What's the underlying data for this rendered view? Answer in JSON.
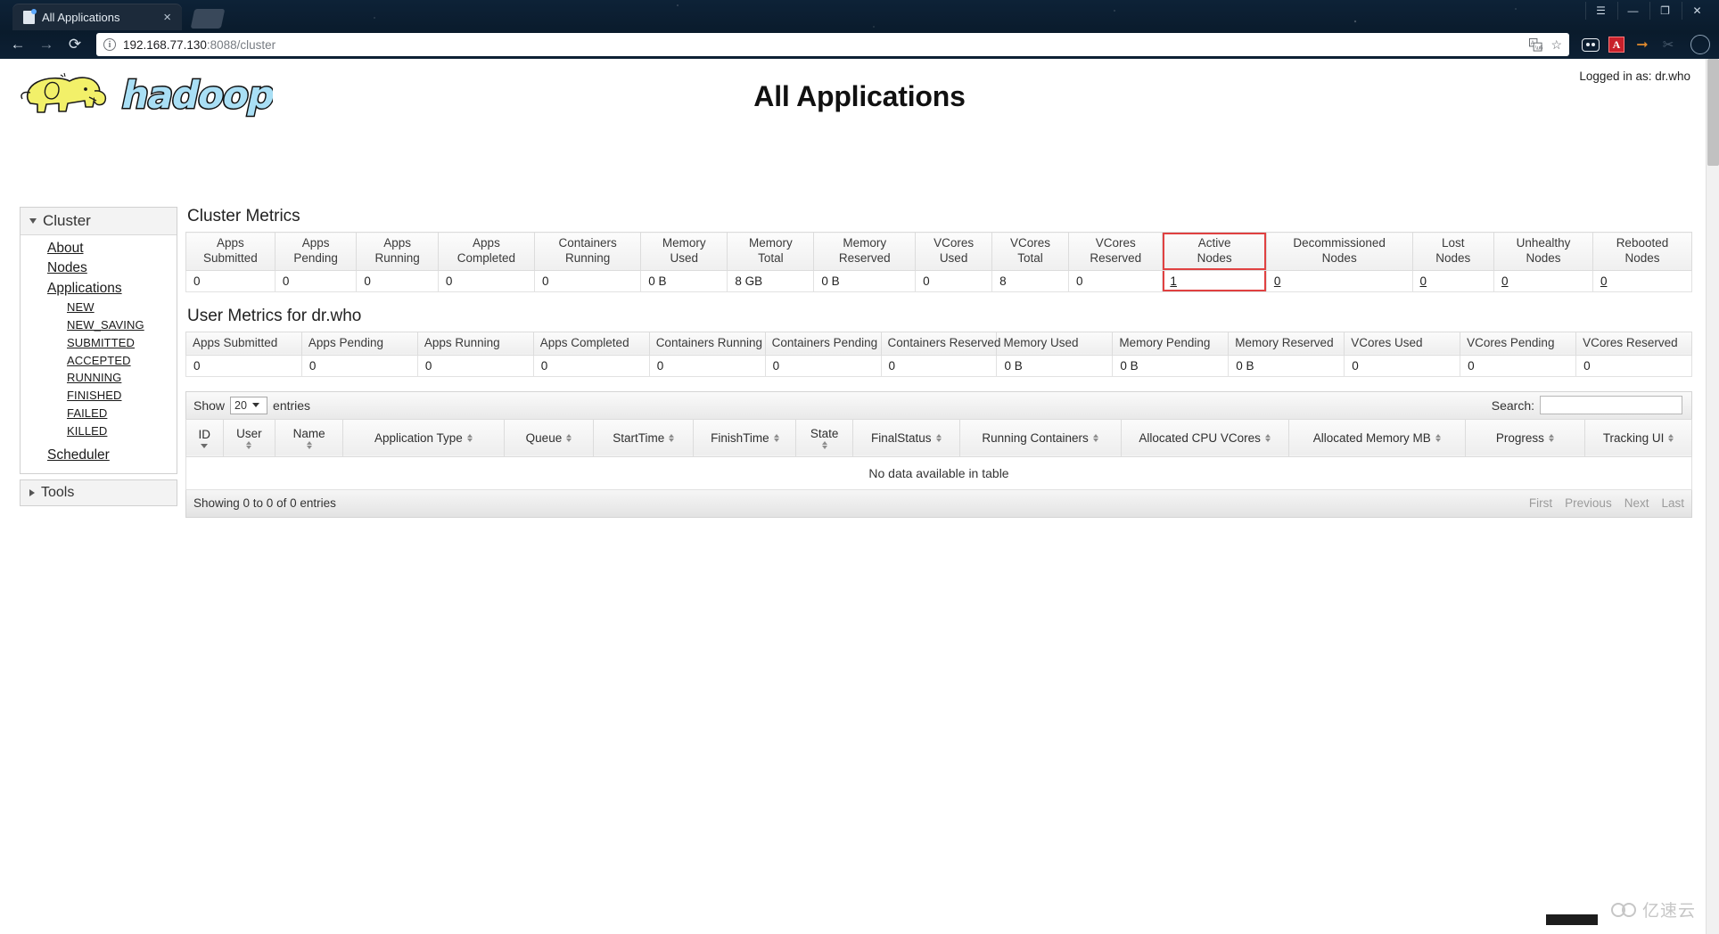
{
  "browser": {
    "tab": {
      "title": "All Applications",
      "close_label": "×",
      "favicon": "page-icon"
    },
    "window_controls": {
      "profile": "☰",
      "minimize": "—",
      "maximize": "❐",
      "close": "✕"
    },
    "nav": {
      "back": "←",
      "forward": "→",
      "reload": "⟳"
    },
    "url": {
      "host": "192.168.77.130",
      "port_path": ":8088/cluster",
      "info_icon": "ⓘ"
    },
    "omni_actions": {
      "translate": "translate-icon",
      "bookmark": "☆"
    },
    "extensions": [
      "oval-icon",
      "pdf-icon",
      "download-arrow-icon",
      "scissors-icon"
    ]
  },
  "header": {
    "logo_text": "hadoop",
    "logged_in": "Logged in as: dr.who",
    "title": "All Applications"
  },
  "sidebar": {
    "cluster": {
      "label": "Cluster",
      "links": [
        "About",
        "Nodes",
        "Applications"
      ],
      "app_states": [
        "NEW",
        "NEW_SAVING",
        "SUBMITTED",
        "ACCEPTED",
        "RUNNING",
        "FINISHED",
        "FAILED",
        "KILLED"
      ],
      "scheduler": "Scheduler"
    },
    "tools": {
      "label": "Tools"
    }
  },
  "cluster_metrics": {
    "title": "Cluster Metrics",
    "columns": [
      {
        "line1": "Apps",
        "line2": "Submitted"
      },
      {
        "line1": "Apps",
        "line2": "Pending"
      },
      {
        "line1": "Apps",
        "line2": "Running"
      },
      {
        "line1": "Apps",
        "line2": "Completed"
      },
      {
        "line1": "Containers",
        "line2": "Running"
      },
      {
        "line1": "Memory",
        "line2": "Used"
      },
      {
        "line1": "Memory",
        "line2": "Total"
      },
      {
        "line1": "Memory",
        "line2": "Reserved"
      },
      {
        "line1": "VCores",
        "line2": "Used"
      },
      {
        "line1": "VCores",
        "line2": "Total"
      },
      {
        "line1": "VCores",
        "line2": "Reserved"
      },
      {
        "line1": "Active",
        "line2": "Nodes"
      },
      {
        "line1": "Decommissioned",
        "line2": "Nodes"
      },
      {
        "line1": "Lost",
        "line2": "Nodes"
      },
      {
        "line1": "Unhealthy",
        "line2": "Nodes"
      },
      {
        "line1": "Rebooted",
        "line2": "Nodes"
      }
    ],
    "values": [
      "0",
      "0",
      "0",
      "0",
      "0",
      "0 B",
      "8 GB",
      "0 B",
      "0",
      "8",
      "0",
      "1",
      "0",
      "0",
      "0",
      "0"
    ],
    "highlight_column": "Active Nodes",
    "highlight_color": "#e04141"
  },
  "user_metrics": {
    "title": "User Metrics for dr.who",
    "columns": [
      "Apps Submitted",
      "Apps Pending",
      "Apps Running",
      "Apps Completed",
      "Containers Running",
      "Containers Pending",
      "Containers Reserved",
      "Memory Used",
      "Memory Pending",
      "Memory Reserved",
      "VCores Used",
      "VCores Pending",
      "VCores Reserved"
    ],
    "values": [
      "0",
      "0",
      "0",
      "0",
      "0",
      "0",
      "0",
      "0 B",
      "0 B",
      "0 B",
      "0",
      "0",
      "0"
    ]
  },
  "apps_table": {
    "show_label": "Show",
    "entries_label": "entries",
    "page_length": "20",
    "search_label": "Search:",
    "search_value": "",
    "search_placeholder": "",
    "columns": [
      "ID",
      "User",
      "Name",
      "Application Type",
      "Queue",
      "StartTime",
      "FinishTime",
      "State",
      "FinalStatus",
      "Running Containers",
      "Allocated CPU VCores",
      "Allocated Memory MB",
      "Progress",
      "Tracking UI"
    ],
    "empty_message": "No data available in table",
    "info": "Showing 0 to 0 of 0 entries",
    "paging": [
      "First",
      "Previous",
      "Next",
      "Last"
    ]
  },
  "watermark": {
    "text": "亿速云"
  }
}
